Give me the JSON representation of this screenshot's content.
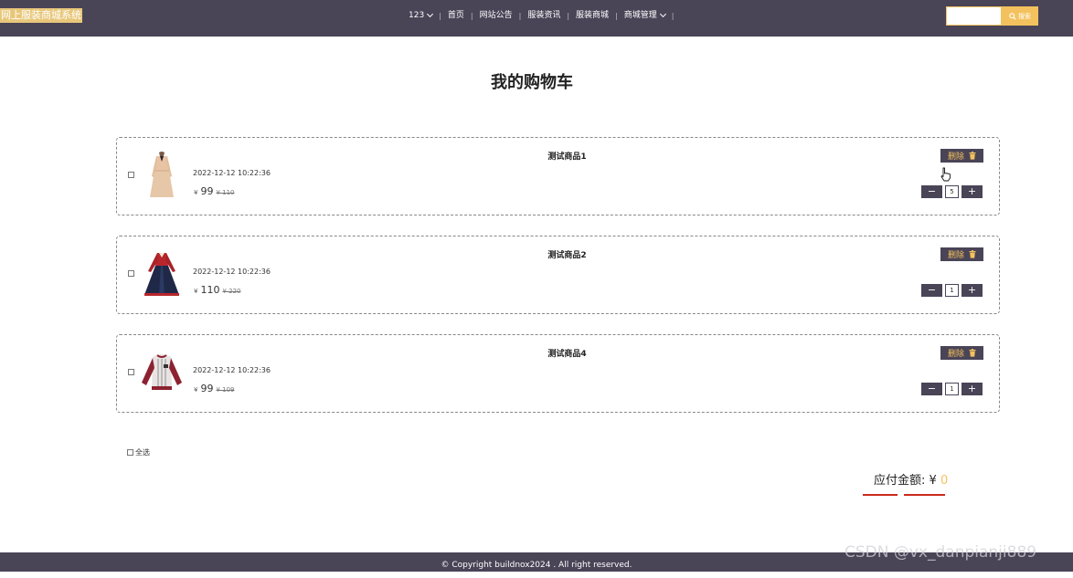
{
  "header": {
    "logo": "网上服装商城系统",
    "nav": [
      {
        "label": "123",
        "dropdown": true
      },
      {
        "label": "首页",
        "dropdown": false
      },
      {
        "label": "网站公告",
        "dropdown": false
      },
      {
        "label": "服装资讯",
        "dropdown": false
      },
      {
        "label": "服装商城",
        "dropdown": false
      },
      {
        "label": "商城管理",
        "dropdown": true
      }
    ],
    "search": {
      "placeholder": "",
      "value": "",
      "button_label": "搜索"
    }
  },
  "page_title": "我的购物车",
  "cart_items": [
    {
      "name": "测试商品1",
      "date": "2022-12-12 10:22:36",
      "currency": "¥",
      "price": "99",
      "old_price": "¥ 110",
      "delete_label": "删除",
      "quantity": "5",
      "image": "beige-dress"
    },
    {
      "name": "测试商品2",
      "date": "2022-12-12 10:22:36",
      "currency": "¥",
      "price": "110",
      "old_price": "¥ 220",
      "delete_label": "删除",
      "quantity": "1",
      "image": "navy-red-dress"
    },
    {
      "name": "测试商品4",
      "date": "2022-12-12 10:22:36",
      "currency": "¥",
      "price": "99",
      "old_price": "¥ 109",
      "delete_label": "删除",
      "quantity": "1",
      "image": "baseball-jacket"
    }
  ],
  "qty_minus": "−",
  "qty_plus": "+",
  "select_all_label": "全选",
  "total": {
    "label": "应付金额: ¥",
    "amount": "0"
  },
  "footer": "© Copyright buildnox2024 . All right reserved.",
  "watermark": "CSDN @vx_danpianji889",
  "colors": {
    "header_bg": "#4a4457",
    "accent": "#f3c25e",
    "underline": "#cc2a1e"
  }
}
